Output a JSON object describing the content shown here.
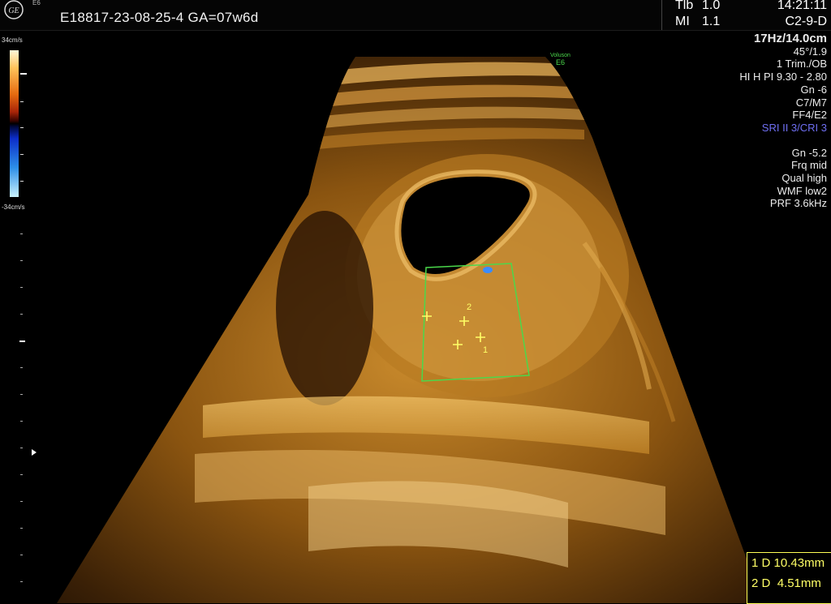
{
  "header": {
    "logo_text": "GE",
    "logo_sub": "E6",
    "patient_line": "E18817-23-08-25-4   GA=07w6d",
    "tib_label": "Tlb",
    "tib_value": "1.0",
    "mi_label": "MI",
    "mi_value": "1.1",
    "time": "14:21:11",
    "probe": "C2-9-D"
  },
  "params": [
    "17Hz/14.0cm",
    "45°/1.9",
    "1 Trim./OB",
    "HI H PI 9.30 - 2.80",
    "Gn  -6",
    "C7/M7",
    "FF4/E2",
    "SRI II 3/CRI 3"
  ],
  "color_params": [
    "Gn -5.2",
    "Frq mid",
    "Qual high",
    "WMF low2",
    "PRF  3.6kHz"
  ],
  "colorbar": {
    "top_label": "34cm/s",
    "bottom_label": "-34cm/s"
  },
  "valuson": {
    "line1": "Voluson",
    "line2": "E6"
  },
  "calipers": {
    "label_1": "1",
    "label_2": "2"
  },
  "measurements": [
    {
      "index": "1",
      "type": "D",
      "value": "10.43mm"
    },
    {
      "index": "2",
      "type": "D",
      "value": "4.51mm"
    }
  ],
  "colors": {
    "accent_yellow": "#ffff66",
    "roi_green": "#4bd84b",
    "sri_blue": "#6f6ff2"
  }
}
